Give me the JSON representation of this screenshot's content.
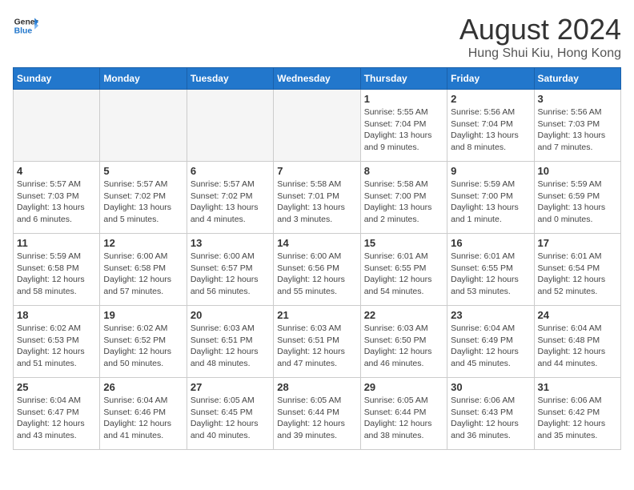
{
  "header": {
    "logo_general": "General",
    "logo_blue": "Blue",
    "month_title": "August 2024",
    "location": "Hung Shui Kiu, Hong Kong"
  },
  "days_of_week": [
    "Sunday",
    "Monday",
    "Tuesday",
    "Wednesday",
    "Thursday",
    "Friday",
    "Saturday"
  ],
  "weeks": [
    [
      null,
      null,
      null,
      null,
      {
        "day": 1,
        "sunrise": "5:55 AM",
        "sunset": "7:04 PM",
        "daylight": "13 hours and 9 minutes."
      },
      {
        "day": 2,
        "sunrise": "5:56 AM",
        "sunset": "7:04 PM",
        "daylight": "13 hours and 8 minutes."
      },
      {
        "day": 3,
        "sunrise": "5:56 AM",
        "sunset": "7:03 PM",
        "daylight": "13 hours and 7 minutes."
      }
    ],
    [
      {
        "day": 4,
        "sunrise": "5:57 AM",
        "sunset": "7:03 PM",
        "daylight": "13 hours and 6 minutes."
      },
      {
        "day": 5,
        "sunrise": "5:57 AM",
        "sunset": "7:02 PM",
        "daylight": "13 hours and 5 minutes."
      },
      {
        "day": 6,
        "sunrise": "5:57 AM",
        "sunset": "7:02 PM",
        "daylight": "13 hours and 4 minutes."
      },
      {
        "day": 7,
        "sunrise": "5:58 AM",
        "sunset": "7:01 PM",
        "daylight": "13 hours and 3 minutes."
      },
      {
        "day": 8,
        "sunrise": "5:58 AM",
        "sunset": "7:00 PM",
        "daylight": "13 hours and 2 minutes."
      },
      {
        "day": 9,
        "sunrise": "5:59 AM",
        "sunset": "7:00 PM",
        "daylight": "13 hours and 1 minute."
      },
      {
        "day": 10,
        "sunrise": "5:59 AM",
        "sunset": "6:59 PM",
        "daylight": "13 hours and 0 minutes."
      }
    ],
    [
      {
        "day": 11,
        "sunrise": "5:59 AM",
        "sunset": "6:58 PM",
        "daylight": "12 hours and 58 minutes."
      },
      {
        "day": 12,
        "sunrise": "6:00 AM",
        "sunset": "6:58 PM",
        "daylight": "12 hours and 57 minutes."
      },
      {
        "day": 13,
        "sunrise": "6:00 AM",
        "sunset": "6:57 PM",
        "daylight": "12 hours and 56 minutes."
      },
      {
        "day": 14,
        "sunrise": "6:00 AM",
        "sunset": "6:56 PM",
        "daylight": "12 hours and 55 minutes."
      },
      {
        "day": 15,
        "sunrise": "6:01 AM",
        "sunset": "6:55 PM",
        "daylight": "12 hours and 54 minutes."
      },
      {
        "day": 16,
        "sunrise": "6:01 AM",
        "sunset": "6:55 PM",
        "daylight": "12 hours and 53 minutes."
      },
      {
        "day": 17,
        "sunrise": "6:01 AM",
        "sunset": "6:54 PM",
        "daylight": "12 hours and 52 minutes."
      }
    ],
    [
      {
        "day": 18,
        "sunrise": "6:02 AM",
        "sunset": "6:53 PM",
        "daylight": "12 hours and 51 minutes."
      },
      {
        "day": 19,
        "sunrise": "6:02 AM",
        "sunset": "6:52 PM",
        "daylight": "12 hours and 50 minutes."
      },
      {
        "day": 20,
        "sunrise": "6:03 AM",
        "sunset": "6:51 PM",
        "daylight": "12 hours and 48 minutes."
      },
      {
        "day": 21,
        "sunrise": "6:03 AM",
        "sunset": "6:51 PM",
        "daylight": "12 hours and 47 minutes."
      },
      {
        "day": 22,
        "sunrise": "6:03 AM",
        "sunset": "6:50 PM",
        "daylight": "12 hours and 46 minutes."
      },
      {
        "day": 23,
        "sunrise": "6:04 AM",
        "sunset": "6:49 PM",
        "daylight": "12 hours and 45 minutes."
      },
      {
        "day": 24,
        "sunrise": "6:04 AM",
        "sunset": "6:48 PM",
        "daylight": "12 hours and 44 minutes."
      }
    ],
    [
      {
        "day": 25,
        "sunrise": "6:04 AM",
        "sunset": "6:47 PM",
        "daylight": "12 hours and 43 minutes."
      },
      {
        "day": 26,
        "sunrise": "6:04 AM",
        "sunset": "6:46 PM",
        "daylight": "12 hours and 41 minutes."
      },
      {
        "day": 27,
        "sunrise": "6:05 AM",
        "sunset": "6:45 PM",
        "daylight": "12 hours and 40 minutes."
      },
      {
        "day": 28,
        "sunrise": "6:05 AM",
        "sunset": "6:44 PM",
        "daylight": "12 hours and 39 minutes."
      },
      {
        "day": 29,
        "sunrise": "6:05 AM",
        "sunset": "6:44 PM",
        "daylight": "12 hours and 38 minutes."
      },
      {
        "day": 30,
        "sunrise": "6:06 AM",
        "sunset": "6:43 PM",
        "daylight": "12 hours and 36 minutes."
      },
      {
        "day": 31,
        "sunrise": "6:06 AM",
        "sunset": "6:42 PM",
        "daylight": "12 hours and 35 minutes."
      }
    ]
  ]
}
